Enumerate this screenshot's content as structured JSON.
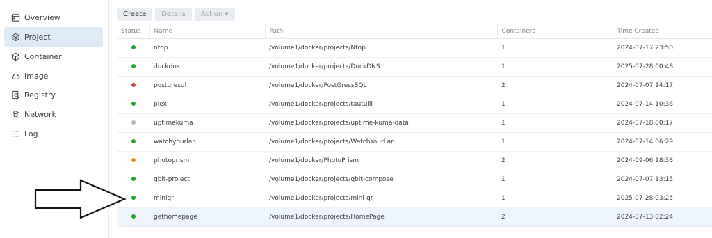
{
  "sidebar": {
    "items": [
      {
        "label": "Overview",
        "icon": "overview-icon"
      },
      {
        "label": "Project",
        "icon": "project-icon",
        "active": true
      },
      {
        "label": "Container",
        "icon": "container-icon"
      },
      {
        "label": "Image",
        "icon": "cloud-icon"
      },
      {
        "label": "Registry",
        "icon": "registry-icon"
      },
      {
        "label": "Network",
        "icon": "network-icon"
      },
      {
        "label": "Log",
        "icon": "list-icon"
      }
    ]
  },
  "toolbar": {
    "create_label": "Create",
    "details_label": "Details",
    "action_label": "Action"
  },
  "table": {
    "columns": [
      "Status",
      "Name",
      "Path",
      "Containers",
      "Time Created"
    ],
    "rows": [
      {
        "status": "green",
        "name": "ntop",
        "path": "/volume1/docker/projects/Ntop",
        "containers": "1",
        "time": "2024-07-17 23:50"
      },
      {
        "status": "green",
        "name": "duckdns",
        "path": "/volume1/docker/projects/DuckDNS",
        "containers": "1",
        "time": "2025-07-28 00:48"
      },
      {
        "status": "red",
        "name": "postgresql",
        "path": "/volume1/docker/PostGressSQL",
        "containers": "2",
        "time": "2024-07-07 14:17"
      },
      {
        "status": "green",
        "name": "plex",
        "path": "/volume1/docker/projects/tautulli",
        "containers": "1",
        "time": "2024-07-14 10:36"
      },
      {
        "status": "gray",
        "name": "uptimekuma",
        "path": "/volume1/docker/projects/uptime-kuma-data",
        "containers": "1",
        "time": "2024-07-18 00:17"
      },
      {
        "status": "green",
        "name": "watchyourlan",
        "path": "/volume1/docker/projects/WatchYourLan",
        "containers": "1",
        "time": "2024-07-14 06:29"
      },
      {
        "status": "orange",
        "name": "photoprism",
        "path": "/volume1/docker/PhotoPrism",
        "containers": "2",
        "time": "2024-09-06 18:38"
      },
      {
        "status": "green",
        "name": "qbit-project",
        "path": "/volume1/docker/projects/qbit-compose",
        "containers": "1",
        "time": "2024-07-07 13:15"
      },
      {
        "status": "green",
        "name": "miniqr",
        "path": "/volume1/docker/projects/mini-qr",
        "containers": "1",
        "time": "2025-07-28 03:25"
      },
      {
        "status": "green",
        "name": "gethomepage",
        "path": "/volume1/docker/projects/HomePage",
        "containers": "2",
        "time": "2024-07-13 02:24",
        "selected": true
      }
    ]
  },
  "colors": {
    "green": "#1fa32a",
    "red": "#d9403a",
    "gray": "#b3b7bc",
    "orange": "#f08a24",
    "active_nav": "#dfeaf7"
  }
}
